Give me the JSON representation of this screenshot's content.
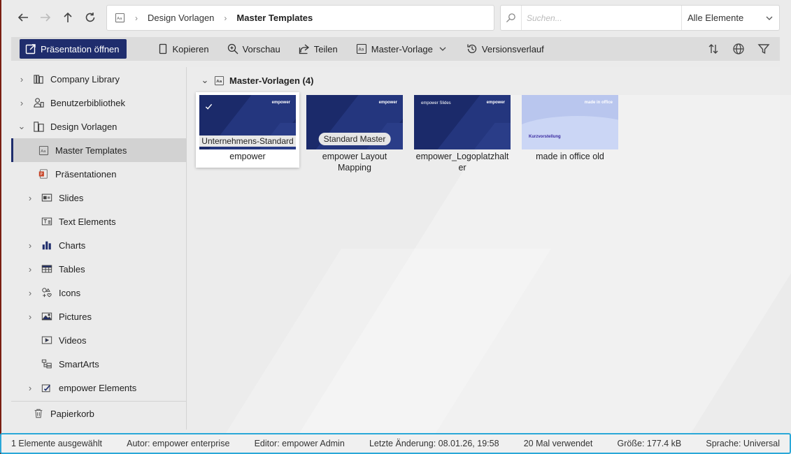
{
  "breadcrumb": {
    "items": [
      "Design Vorlagen",
      "Master Templates"
    ]
  },
  "search": {
    "placeholder": "Suchen...",
    "filter_value": "Alle Elemente"
  },
  "toolbar": {
    "open_label": "Präsentation öffnen",
    "copy_label": "Kopieren",
    "preview_label": "Vorschau",
    "share_label": "Teilen",
    "master_label": "Master-Vorlage",
    "history_label": "Versionsverlauf"
  },
  "sidebar": {
    "items": [
      {
        "label": "Company Library",
        "icon": "library-icon"
      },
      {
        "label": "Benutzerbibliothek",
        "icon": "user-library-icon"
      },
      {
        "label": "Design Vorlagen",
        "icon": "design-template-icon"
      },
      {
        "label": "Master Templates",
        "icon": "master-template-icon"
      },
      {
        "label": "Präsentationen",
        "icon": "powerpoint-icon"
      },
      {
        "label": "Slides",
        "icon": "slides-icon"
      },
      {
        "label": "Text Elements",
        "icon": "text-element-icon"
      },
      {
        "label": "Charts",
        "icon": "chart-icon"
      },
      {
        "label": "Tables",
        "icon": "table-icon"
      },
      {
        "label": "Icons",
        "icon": "icons-icon"
      },
      {
        "label": "Pictures",
        "icon": "picture-icon"
      },
      {
        "label": "Videos",
        "icon": "video-icon"
      },
      {
        "label": "SmartArts",
        "icon": "smartart-icon"
      },
      {
        "label": "empower Elements",
        "icon": "empower-elements-icon"
      },
      {
        "label": "Papierkorb",
        "icon": "trash-icon"
      }
    ]
  },
  "group": {
    "title": "Master-Vorlagen (4)"
  },
  "tiles": [
    {
      "label": "empower",
      "tag": "Unternehmens-Standard",
      "logo": "empower"
    },
    {
      "label": "empower Layout Mapping",
      "tag": "Standard Master",
      "logo": "empower"
    },
    {
      "label": "empower_Logoplatzhalter",
      "logo": "empower",
      "sub": "empower Slides"
    },
    {
      "label": "made in office old",
      "logo": "made in office",
      "sub": "Kurzvorstellung"
    }
  ],
  "status": {
    "selected": "1 Elemente ausgewählt",
    "author": "Autor: empower enterprise",
    "editor": "Editor: empower Admin",
    "modified": "Letzte Änderung: 08.01.26, 19:58",
    "used": "20 Mal verwendet",
    "size": "Größe: 177.4 kB",
    "language": "Sprache: Universal"
  },
  "colors": {
    "accent": "#1f2d6d",
    "status_border": "#2aa8d8"
  }
}
